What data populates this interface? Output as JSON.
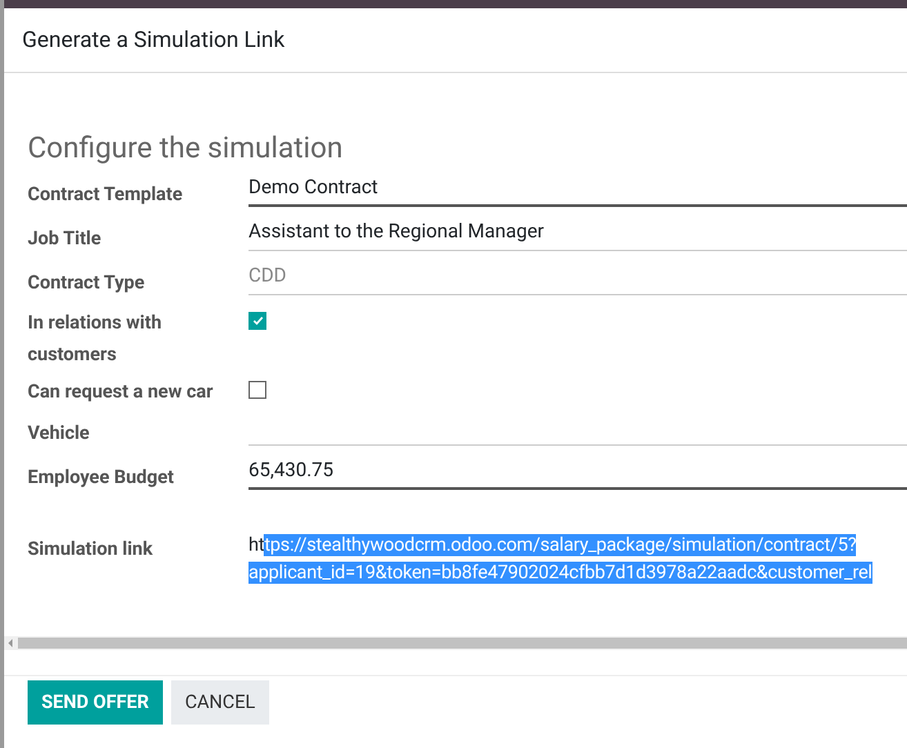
{
  "dialog": {
    "title": "Generate a Simulation Link"
  },
  "section_title": "Configure the simulation",
  "fields": [
    {
      "label": "Contract Template",
      "kind": "text",
      "value": "Demo Contract",
      "required": true
    },
    {
      "label": "Job Title",
      "kind": "text",
      "value": "Assistant to the Regional Manager",
      "required": false
    },
    {
      "label": "Contract Type",
      "kind": "readonly",
      "value": "CDD",
      "required": false
    },
    {
      "label": "In relations with customers",
      "kind": "checkbox",
      "checked": true
    },
    {
      "label": "Can request a new car",
      "kind": "checkbox",
      "checked": false
    },
    {
      "label": "Vehicle",
      "kind": "text",
      "required": false
    },
    {
      "label": "Employee Budget",
      "kind": "text",
      "value": "65,430.75",
      "required": true
    }
  ],
  "simulation_link": {
    "label": "Simulation link",
    "prefix": "ht",
    "lines": [
      "tps://stealthywoodcrm.odoo.com/salary_package/simulation/contract/5?",
      "applicant_id=19&token=bb8fe47902024cfbb7d1d3978a22aadc&customer_rel"
    ],
    "highlighted": true
  },
  "buttons": [
    {
      "label": "SEND OFFER",
      "kind": "primary"
    },
    {
      "label": "CANCEL",
      "kind": "secondary"
    }
  ]
}
